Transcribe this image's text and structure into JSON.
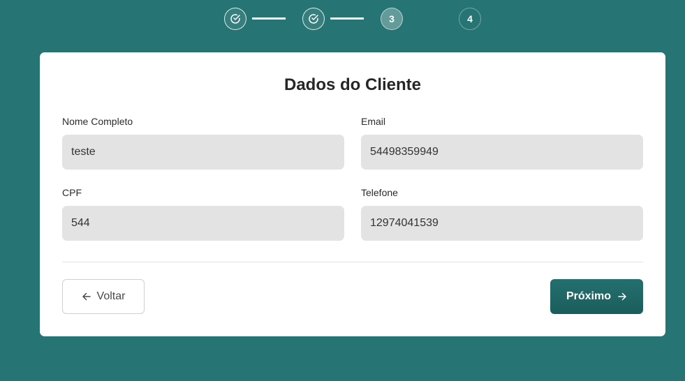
{
  "stepper": {
    "steps": [
      {
        "label": "",
        "status": "done",
        "icon": "check-circle-icon"
      },
      {
        "label": "",
        "status": "done",
        "icon": "check-circle-icon"
      },
      {
        "label": "3",
        "status": "active"
      },
      {
        "label": "4",
        "status": "pending"
      }
    ]
  },
  "form": {
    "title": "Dados do Cliente",
    "fields": {
      "nome": {
        "label": "Nome Completo",
        "value": "teste"
      },
      "email": {
        "label": "Email",
        "value": "54498359949"
      },
      "cpf": {
        "label": "CPF",
        "value": "544"
      },
      "telefone": {
        "label": "Telefone",
        "value": "12974041539"
      }
    }
  },
  "actions": {
    "back_label": "Voltar",
    "back_icon": "arrow-left-icon",
    "next_label": "Próximo",
    "next_icon": "arrow-right-icon"
  },
  "colors": {
    "background": "#267574",
    "primary_button": "#1f6766",
    "input_background": "#e3e3e3"
  }
}
